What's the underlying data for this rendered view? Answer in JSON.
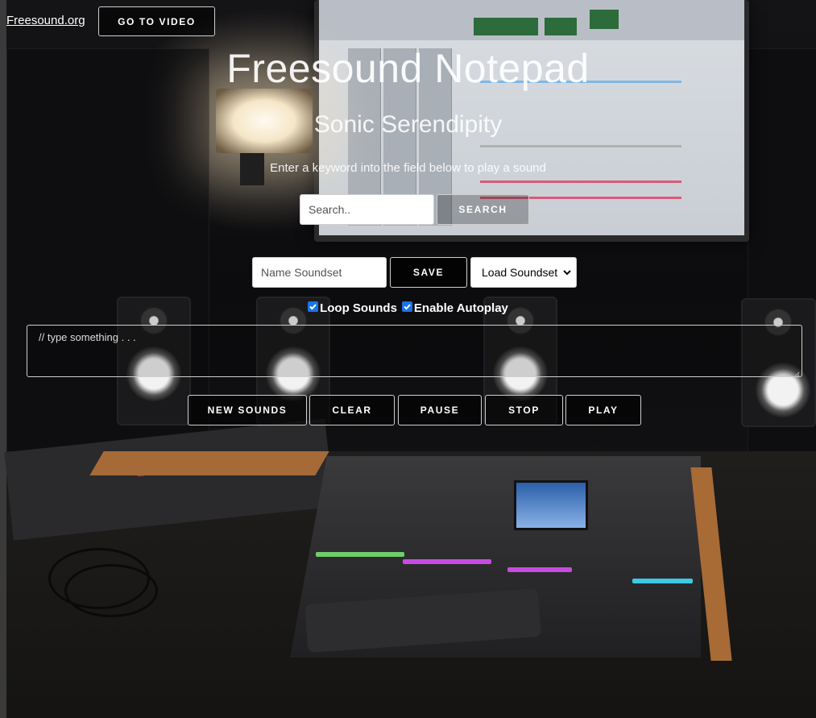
{
  "header": {
    "site_link": "Freesound.org",
    "video_button": "GO TO VIDEO"
  },
  "hero": {
    "title": "Freesound Notepad",
    "subtitle": "Sonic Serendipity",
    "instructions": "Enter a keyword into the field below to play a sound"
  },
  "search": {
    "placeholder": "Search..",
    "button_label": "SEARCH"
  },
  "soundset": {
    "name_placeholder": "Name Soundset",
    "save_label": "SAVE",
    "load_selected": "Load Soundset"
  },
  "options": {
    "loop_label": "Loop Sounds",
    "loop_checked": true,
    "autoplay_label": "Enable Autoplay",
    "autoplay_checked": true
  },
  "notepad": {
    "placeholder": "// type something . . ."
  },
  "controls": {
    "new_sounds": "NEW SOUNDS",
    "clear": "CLEAR",
    "pause": "PAUSE",
    "stop": "STOP",
    "play": "PLAY"
  },
  "colors": {
    "checkbox_accent": "#1a73e8",
    "button_border": "#cfcfcf"
  }
}
